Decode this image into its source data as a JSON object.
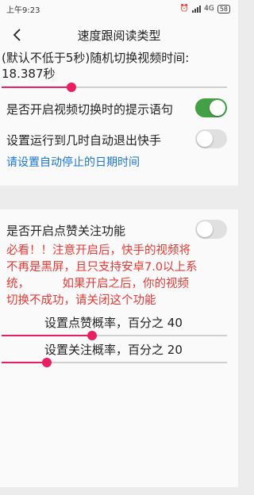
{
  "status_bar": {
    "time": "上午9:23",
    "network": "4G",
    "battery": "58",
    "alarm_icon": "alarm-icon",
    "signal_icon": "signal-icon"
  },
  "app_bar": {
    "title": "速度跟阅读类型",
    "back_icon": "back-arrow-icon"
  },
  "video_switch": {
    "label": "(默认不低于5秒)随机切换视频时间:",
    "value_text": "18.387秒",
    "slider_fraction": 0.31
  },
  "switch_prompt": {
    "label": "是否开启视频切换时的提示语句",
    "on": true
  },
  "auto_exit": {
    "label": "设置运行到几时自动退出快手",
    "on": false,
    "link": "请设置自动停止的日期时间"
  },
  "like_follow": {
    "label": "是否开启点赞关注功能",
    "on": false
  },
  "warning": {
    "line1": "必看！！注意开启后，快手的视频将",
    "line2": "不再是黑屏，且只支持安卓7.0以上系",
    "line3": "统，         如果开启之后，你的视频",
    "line4": "切换不成功，请关闭这个功能"
  },
  "like_rate": {
    "label": "设置点赞概率，百分之 40",
    "percent": 40
  },
  "follow_rate": {
    "label": "设置关注概率，百分之 20",
    "percent": 20
  },
  "colors": {
    "accent": "#e91e63",
    "toggle_on": "#43a047",
    "link": "#1976d2",
    "warning": "#e53935"
  }
}
